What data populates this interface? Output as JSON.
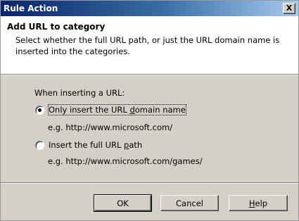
{
  "window": {
    "title": "Rule Action",
    "close_symbol": "X"
  },
  "header": {
    "title": "Add URL to category",
    "description": "Select whether the full URL path, or just the URL domain name is inserted into the categories."
  },
  "options": {
    "group_label": "When inserting a URL:",
    "selected": "domain",
    "domain": {
      "label_pre": "Only insert the URL ",
      "label_mnemonic": "d",
      "label_post": "omain name",
      "example": "e.g. http://www.microsoft.com/"
    },
    "path": {
      "label_pre": "Insert the full URL ",
      "label_mnemonic": "p",
      "label_post": "ath",
      "example": "e.g. http://www.microsoft.com/games/"
    }
  },
  "buttons": {
    "ok": "OK",
    "cancel": "Cancel",
    "help_mnemonic": "H",
    "help_rest": "elp"
  }
}
